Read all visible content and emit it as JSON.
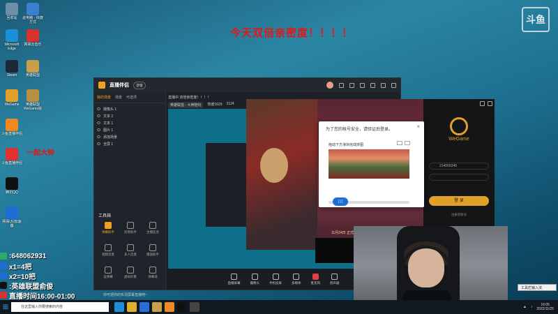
{
  "headline": "今天双倍亲密度！！！！",
  "side_label": "一起大钟",
  "watermark": "斗鱼",
  "desktop_icons": [
    {
      "label": "回收站",
      "icon": "recycle-bin-icon",
      "color": "#6f8fa8"
    },
    {
      "label": "此电脑 - 快捷方式",
      "icon": "computer-icon",
      "color": "#3a7fd0"
    },
    {
      "label": "Microsoft Edge",
      "icon": "edge-icon",
      "color": "#1d8fd8"
    },
    {
      "label": "网易云音乐",
      "icon": "netease-music-icon",
      "color": "#d8322c"
    },
    {
      "label": "Steam",
      "icon": "steam-icon",
      "color": "#1b2838"
    },
    {
      "label": "英雄联盟",
      "icon": "lol-icon",
      "color": "#c8a04c"
    },
    {
      "label": "WeGame",
      "icon": "wegame-icon",
      "color": "#e0a02a"
    },
    {
      "label": "英雄联盟WeGame版",
      "icon": "lol-wegame-icon",
      "color": "#b89040"
    },
    {
      "label": "斗鱼直播伴侣",
      "icon": "douyu-icon",
      "color": "#f08a20"
    },
    {
      "label": "斗鱼直播伴侣",
      "icon": "douyu-companion-icon",
      "color": "#e03030"
    },
    {
      "label": "腾讯QQ",
      "icon": "qq-icon",
      "color": "#111111"
    },
    {
      "label": "网易UU加速器",
      "icon": "uu-icon",
      "color": "#1e6ed6"
    }
  ],
  "app": {
    "title": "直播伴侣",
    "badge": "游客",
    "tabs": [
      "我的场景",
      "场景",
      "可选项"
    ],
    "scenes": [
      "摄像头 1",
      "文本 2",
      "文本 1",
      "图片 1",
      "添加场景",
      "全屏 1"
    ],
    "info_line1": "直播中  双倍亲密度！！！！",
    "info_line2": [
      "英雄联盟 - 大神陪玩",
      "热度1629",
      "2124"
    ],
    "tools_title": "工具箱",
    "tools": [
      {
        "label": "弹幕助手",
        "hot": true
      },
      {
        "label": "房管助手",
        "hot": false
      },
      {
        "label": "主播任务",
        "hot": false
      },
      {
        "label": "视频连麦",
        "hot": false
      },
      {
        "label": "多人连麦",
        "hot": false
      },
      {
        "label": "赠送助手",
        "hot": false
      },
      {
        "label": "设弹幕",
        "hot": false
      },
      {
        "label": "虚拟形象",
        "hot": false
      },
      {
        "label": "弹幕墙",
        "hot": false
      }
    ],
    "bottom_buttons": [
      {
        "label": "直播屏幕",
        "live": false
      },
      {
        "label": "摄像头",
        "live": false
      },
      {
        "label": "手机投屏",
        "live": false
      },
      {
        "label": "多媒体",
        "live": false
      },
      {
        "label": "麦克风",
        "live": true
      },
      {
        "label": "扬声器",
        "live": false
      }
    ],
    "bottom_hint": "你可把你的实况屏幕直播吧~"
  },
  "game": {
    "date": "11月24日 正式上线",
    "wegame": {
      "brand": "WeGame",
      "account": "214066345",
      "login": "登 录",
      "register": "注册新账号"
    }
  },
  "captcha": {
    "title": "为了您的帐号安全，请验证后登录。",
    "hint": "拖动下方滑块完成拼图",
    "knob": "| | |"
  },
  "overlay": [
    {
      "icon": "wechat-icon",
      "text": ":648062931",
      "color": "#2aae67"
    },
    {
      "icon": "number-one-icon",
      "text": "x1=4把",
      "color": "#1e6ed6"
    },
    {
      "icon": "number-two-icon",
      "text": "x2=10把",
      "color": "#1e6ed6"
    },
    {
      "icon": "tiktok-icon",
      "text": ":英雄联盟俞俊",
      "color": "#111111"
    },
    {
      "icon": "live-icon",
      "text": "直播时间16:00-01:00",
      "color": "#d8322c"
    }
  ],
  "taskbar": {
    "search_placeholder": "在这里输入你要搜索的内容",
    "apps": [
      {
        "icon": "edge-tb-icon",
        "color": "#1d8fd8"
      },
      {
        "icon": "folder-tb-icon",
        "color": "#e0b030"
      },
      {
        "icon": "store-tb-icon",
        "color": "#2a6fd8"
      },
      {
        "icon": "game-tb-icon",
        "color": "#c8a04c"
      },
      {
        "icon": "douyu-tb-icon",
        "color": "#f08a20"
      },
      {
        "icon": "qq-tb-icon",
        "color": "#111111"
      },
      {
        "icon": "obs-tb-icon",
        "color": "#444444"
      }
    ],
    "time": "16:05",
    "date": "2022/11/25",
    "popup": "工具栏输入法"
  }
}
